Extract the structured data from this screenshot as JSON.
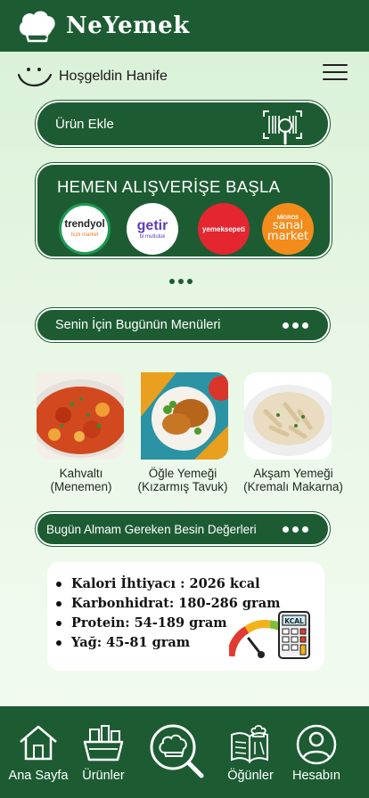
{
  "header": {
    "brand": "NeYemek",
    "logo_icon": "chef-hat-icon"
  },
  "greeting": {
    "text": "Hoşgeldin Hanife",
    "icon": "smile-icon"
  },
  "actions": {
    "add_product_label": "Ürün Ekle",
    "add_product_icon": "barcode-scan-icon"
  },
  "shopping": {
    "title": "HEMEN ALIŞVERİŞE BAŞLA",
    "stores": [
      {
        "name": "trendyol",
        "sub": "hızlı market"
      },
      {
        "name": "getir",
        "sub": "bi mutluluk"
      },
      {
        "name": "yemeksepeti"
      },
      {
        "name": "MİGROS",
        "sub": "sanal market"
      }
    ]
  },
  "menus": {
    "title": "Senin İçin Bugünün Menüleri",
    "meals": [
      {
        "caption_line1": "Kahvaltı",
        "caption_line2": "(Menemen)"
      },
      {
        "caption_line1": "Öğle Yemeği",
        "caption_line2": "(Kızarmış Tavuk)"
      },
      {
        "caption_line1": "Akşam Yemeği",
        "caption_line2": "(Kremalı Makarna)"
      }
    ]
  },
  "nutrition": {
    "title": "Bugün Almam Gereken Besin Değerleri",
    "items": [
      "Kalori İhtiyacı : 2026 kcal",
      "Karbonhidrat: 180-286 gram",
      "Protein: 54-189 gram",
      "Yağ: 45-81 gram"
    ],
    "kcal_label": "KCAL"
  },
  "nav": {
    "items": [
      {
        "label": "Ana Sayfa",
        "icon": "home-icon"
      },
      {
        "label": "Ürünler",
        "icon": "groceries-icon"
      },
      {
        "label": "",
        "icon": "search-hat-icon"
      },
      {
        "label": "Öğünler",
        "icon": "recipe-book-icon"
      },
      {
        "label": "Hesabın",
        "icon": "account-icon"
      }
    ]
  },
  "colors": {
    "primary": "#1d5c33",
    "background": "#e3f4e0"
  }
}
